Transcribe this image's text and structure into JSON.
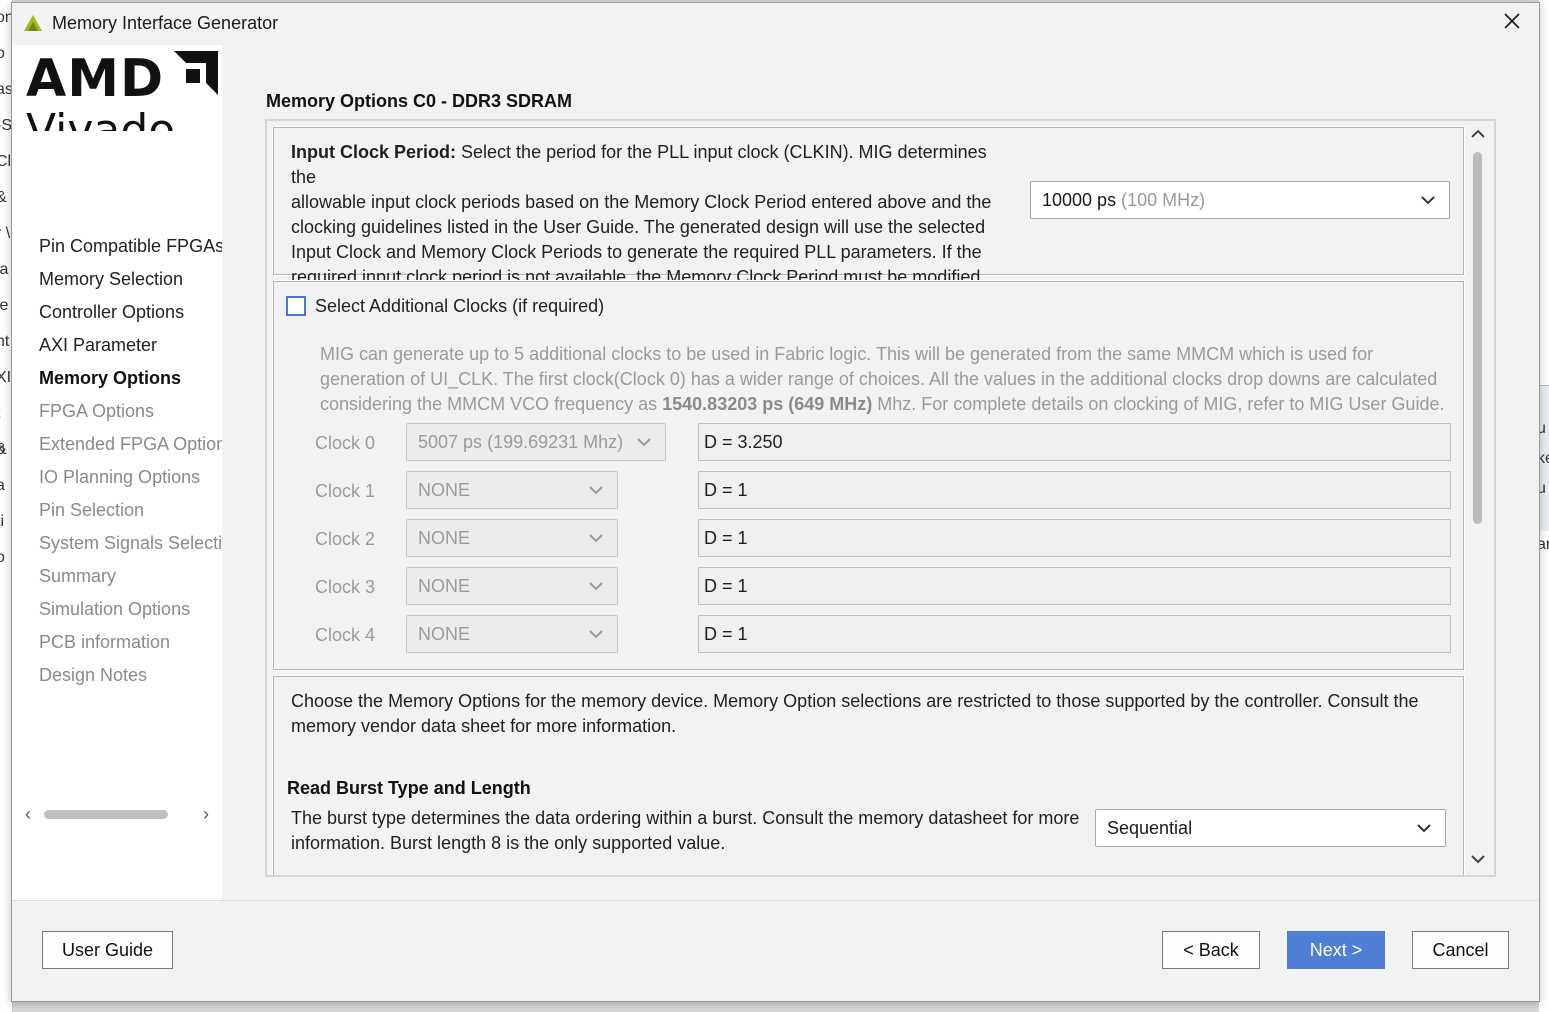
{
  "background": {
    "left_fragments": [
      "on",
      "o",
      "as",
      "-S",
      "Cl",
      "&",
      "r \\",
      "la",
      "le",
      "nt",
      "XI",
      "t &",
      "o",
      "a",
      "ti",
      "o"
    ],
    "right_fragments": [
      "u",
      "ke",
      "u",
      "ar"
    ]
  },
  "window": {
    "title": "Memory Interface Generator"
  },
  "brand": {
    "amd": "AMD",
    "vivado": "Vivado"
  },
  "sidebar": {
    "steps": [
      {
        "label": "Pin Compatible FPGAs",
        "state": "done"
      },
      {
        "label": "Memory Selection",
        "state": "done"
      },
      {
        "label": "Controller Options",
        "state": "done"
      },
      {
        "label": "AXI Parameter",
        "state": "done"
      },
      {
        "label": "Memory Options",
        "state": "current"
      },
      {
        "label": "FPGA Options",
        "state": "todo"
      },
      {
        "label": "Extended FPGA Options",
        "state": "todo"
      },
      {
        "label": "IO Planning Options",
        "state": "todo"
      },
      {
        "label": "Pin Selection",
        "state": "todo"
      },
      {
        "label": "System Signals Selection",
        "state": "todo"
      },
      {
        "label": "Summary",
        "state": "todo"
      },
      {
        "label": "Simulation Options",
        "state": "todo"
      },
      {
        "label": "PCB information",
        "state": "todo"
      },
      {
        "label": "Design Notes",
        "state": "todo"
      }
    ]
  },
  "content": {
    "title": "Memory Options C0 - DDR3 SDRAM",
    "input_clock": {
      "label": "Input Clock Period:",
      "lines": [
        "Select the period for the PLL input clock (CLKIN). MIG determines the",
        "allowable input clock periods based on the Memory Clock Period entered above and the",
        "clocking guidelines listed in the User Guide. The generated design will use the selected",
        "Input Clock and Memory Clock Periods to generate the required PLL parameters. If the",
        "required input clock period is not available, the Memory Clock Period must be modified."
      ],
      "value": "10000 ps",
      "value_hint": "(100 MHz)"
    },
    "additional_clocks": {
      "checkbox_label": "Select Additional Clocks (if required)",
      "checked": false,
      "desc_line1": "MIG can generate up to 5 additional clocks to be used in Fabric logic. This will be generated from the same MMCM which is used for",
      "desc_line2": "generation of UI_CLK. The first clock(Clock 0) has a wider range of choices. All the values in the additional clocks drop downs are calculated",
      "desc_line3_pre": "considering the MMCM VCO frequency as ",
      "desc_line3_bold": "1540.83203 ps (649 MHz)",
      "desc_line3_post": " Mhz. For complete details on clocking of MIG, refer to MIG User Guide.",
      "clocks": [
        {
          "label": "Clock 0",
          "value": "5007 ps",
          "value_hint": "(199.69231 Mhz)",
          "divider": "D =  3.250"
        },
        {
          "label": "Clock 1",
          "value": "NONE",
          "divider": "D = 1"
        },
        {
          "label": "Clock 2",
          "value": "NONE",
          "divider": "D = 1"
        },
        {
          "label": "Clock 3",
          "value": "NONE",
          "divider": "D = 1"
        },
        {
          "label": "Clock 4",
          "value": "NONE",
          "divider": "D = 1"
        }
      ]
    },
    "memory_options": {
      "intro_line1": "Choose the Memory Options for the memory device. Memory Option selections are restricted to those supported by the controller. Consult the",
      "intro_line2": "memory vendor data sheet for more information.",
      "burst_heading": "Read Burst Type and Length",
      "burst_line1": "The burst type determines the data ordering within a burst. Consult the memory datasheet for more",
      "burst_line2": "information. Burst length 8 is the only supported value.",
      "burst_value": "Sequential"
    }
  },
  "footer": {
    "user_guide": "User Guide",
    "back": "< Back",
    "next": "Next >",
    "cancel": "Cancel"
  },
  "colors": {
    "primary_button": "#4f7fd5",
    "checkbox_border": "#4a78d0",
    "muted_text": "#9a9a9a"
  }
}
